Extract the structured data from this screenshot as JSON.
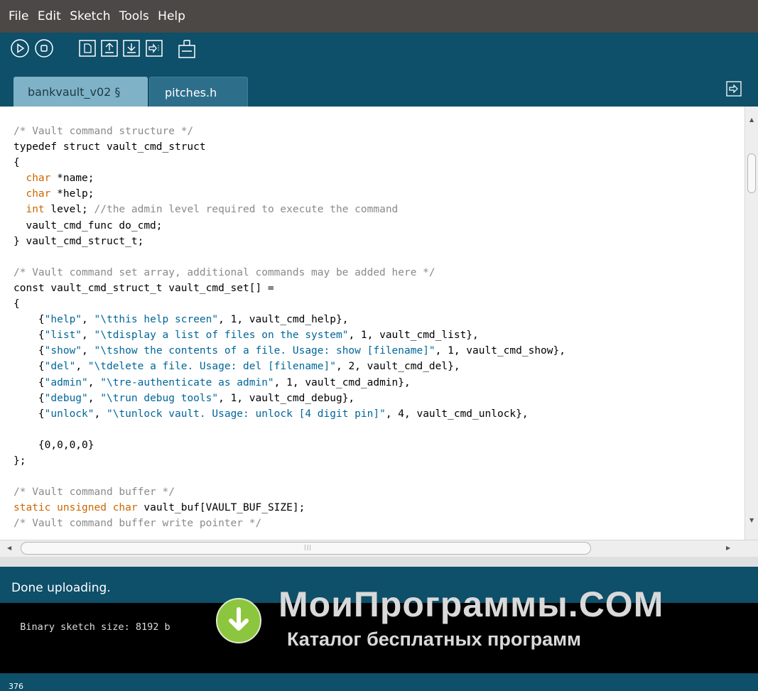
{
  "menu": {
    "items": [
      "File",
      "Edit",
      "Sketch",
      "Tools",
      "Help"
    ]
  },
  "toolbar": {
    "buttons": [
      "verify-icon",
      "stop-icon",
      "new-icon",
      "open-icon",
      "save-icon",
      "upload-icon",
      "serial-monitor-icon"
    ]
  },
  "tabs": [
    {
      "label": "bankvault_v02 §",
      "active": true
    },
    {
      "label": "pitches.h",
      "active": false
    }
  ],
  "editor": {
    "lines": [
      "/* Vault command structure */",
      "typedef struct vault_cmd_struct",
      "{",
      "  char *name;",
      "  char *help;",
      "  int level; //the admin level required to execute the command",
      "  vault_cmd_func do_cmd;",
      "} vault_cmd_struct_t;",
      "",
      "/* Vault command set array, additional commands may be added here */",
      "const vault_cmd_struct_t vault_cmd_set[] =",
      "{",
      "    {\"help\", \"\\tthis help screen\", 1, vault_cmd_help},",
      "    {\"list\", \"\\tdisplay a list of files on the system\", 1, vault_cmd_list},",
      "    {\"show\", \"\\tshow the contents of a file. Usage: show [filename]\", 1, vault_cmd_show},",
      "    {\"del\", \"\\tdelete a file. Usage: del [filename]\", 2, vault_cmd_del},",
      "    {\"admin\", \"\\tre-authenticate as admin\", 1, vault_cmd_admin},",
      "    {\"debug\", \"\\trun debug tools\", 1, vault_cmd_debug},",
      "    {\"unlock\", \"\\tunlock vault. Usage: unlock [4 digit pin]\", 4, vault_cmd_unlock},",
      "",
      "    {0,0,0,0}",
      "};",
      "",
      "/* Vault command buffer */",
      "static unsigned char vault_buf[VAULT_BUF_SIZE];",
      "/* Vault command buffer write pointer */"
    ],
    "colors": {
      "comment": "#8a8a8a",
      "keyword": "#cc6600",
      "string": "#006699"
    }
  },
  "status": {
    "message": "Done uploading."
  },
  "console": {
    "text": "Binary sketch size: 8192 b"
  },
  "footer": {
    "line_number": "376"
  },
  "watermark": {
    "title": "МоиПрограммы.COM",
    "subtitle": "Каталог бесплатных программ"
  },
  "colors": {
    "menubar": "#4b4846",
    "toolbar": "#0e4f69",
    "tab_active": "#7fb2c6",
    "tab_inactive": "#2d6f8b",
    "console_bg": "#000000"
  }
}
